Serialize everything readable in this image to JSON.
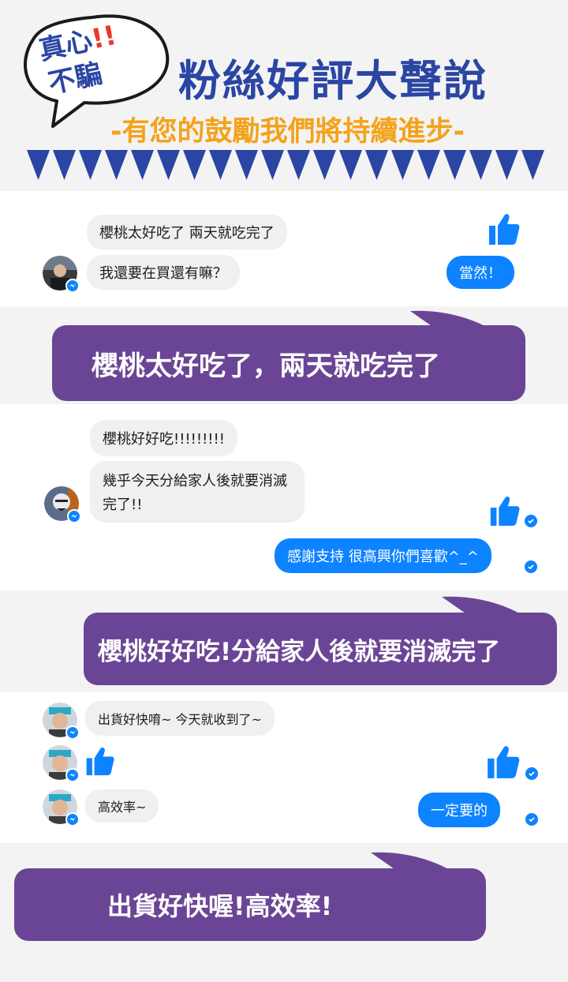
{
  "header": {
    "badge_line1": "真心",
    "badge_line1_mark": "!!",
    "badge_line2": "不騙",
    "title": "粉絲好評大聲說",
    "subtitle": "-有您的鼓勵我們將持續進步-"
  },
  "colors": {
    "brand_blue": "#2a45a3",
    "accent_orange": "#f4a21b",
    "banner_purple": "#6b4595",
    "messenger_blue": "#0d83ff",
    "incoming_bubble": "#f1f0f0"
  },
  "reviews": [
    {
      "incoming": [
        "櫻桃太好吃了 兩天就吃完了",
        "我還要在買還有嘛？"
      ],
      "outgoing": [
        "當然！"
      ],
      "banner": "櫻桃太好吃了，兩天就吃完了"
    },
    {
      "incoming": [
        "櫻桃好好吃!!!!!!!!!",
        "幾乎今天分給家人後就要消滅",
        "完了!!"
      ],
      "outgoing": [
        "感謝支持 很高興你們喜歡^_^"
      ],
      "banner": "櫻桃好好吃!分給家人後就要消滅完了"
    },
    {
      "incoming": [
        "出貨好快唷~ 今天就收到了~",
        "高效率~"
      ],
      "outgoing": [
        "一定要的"
      ],
      "banner": "出貨好快喔!高效率!"
    }
  ],
  "icons": [
    "thumbs-up-icon",
    "messenger-icon",
    "check-icon",
    "speech-bubble-icon"
  ]
}
